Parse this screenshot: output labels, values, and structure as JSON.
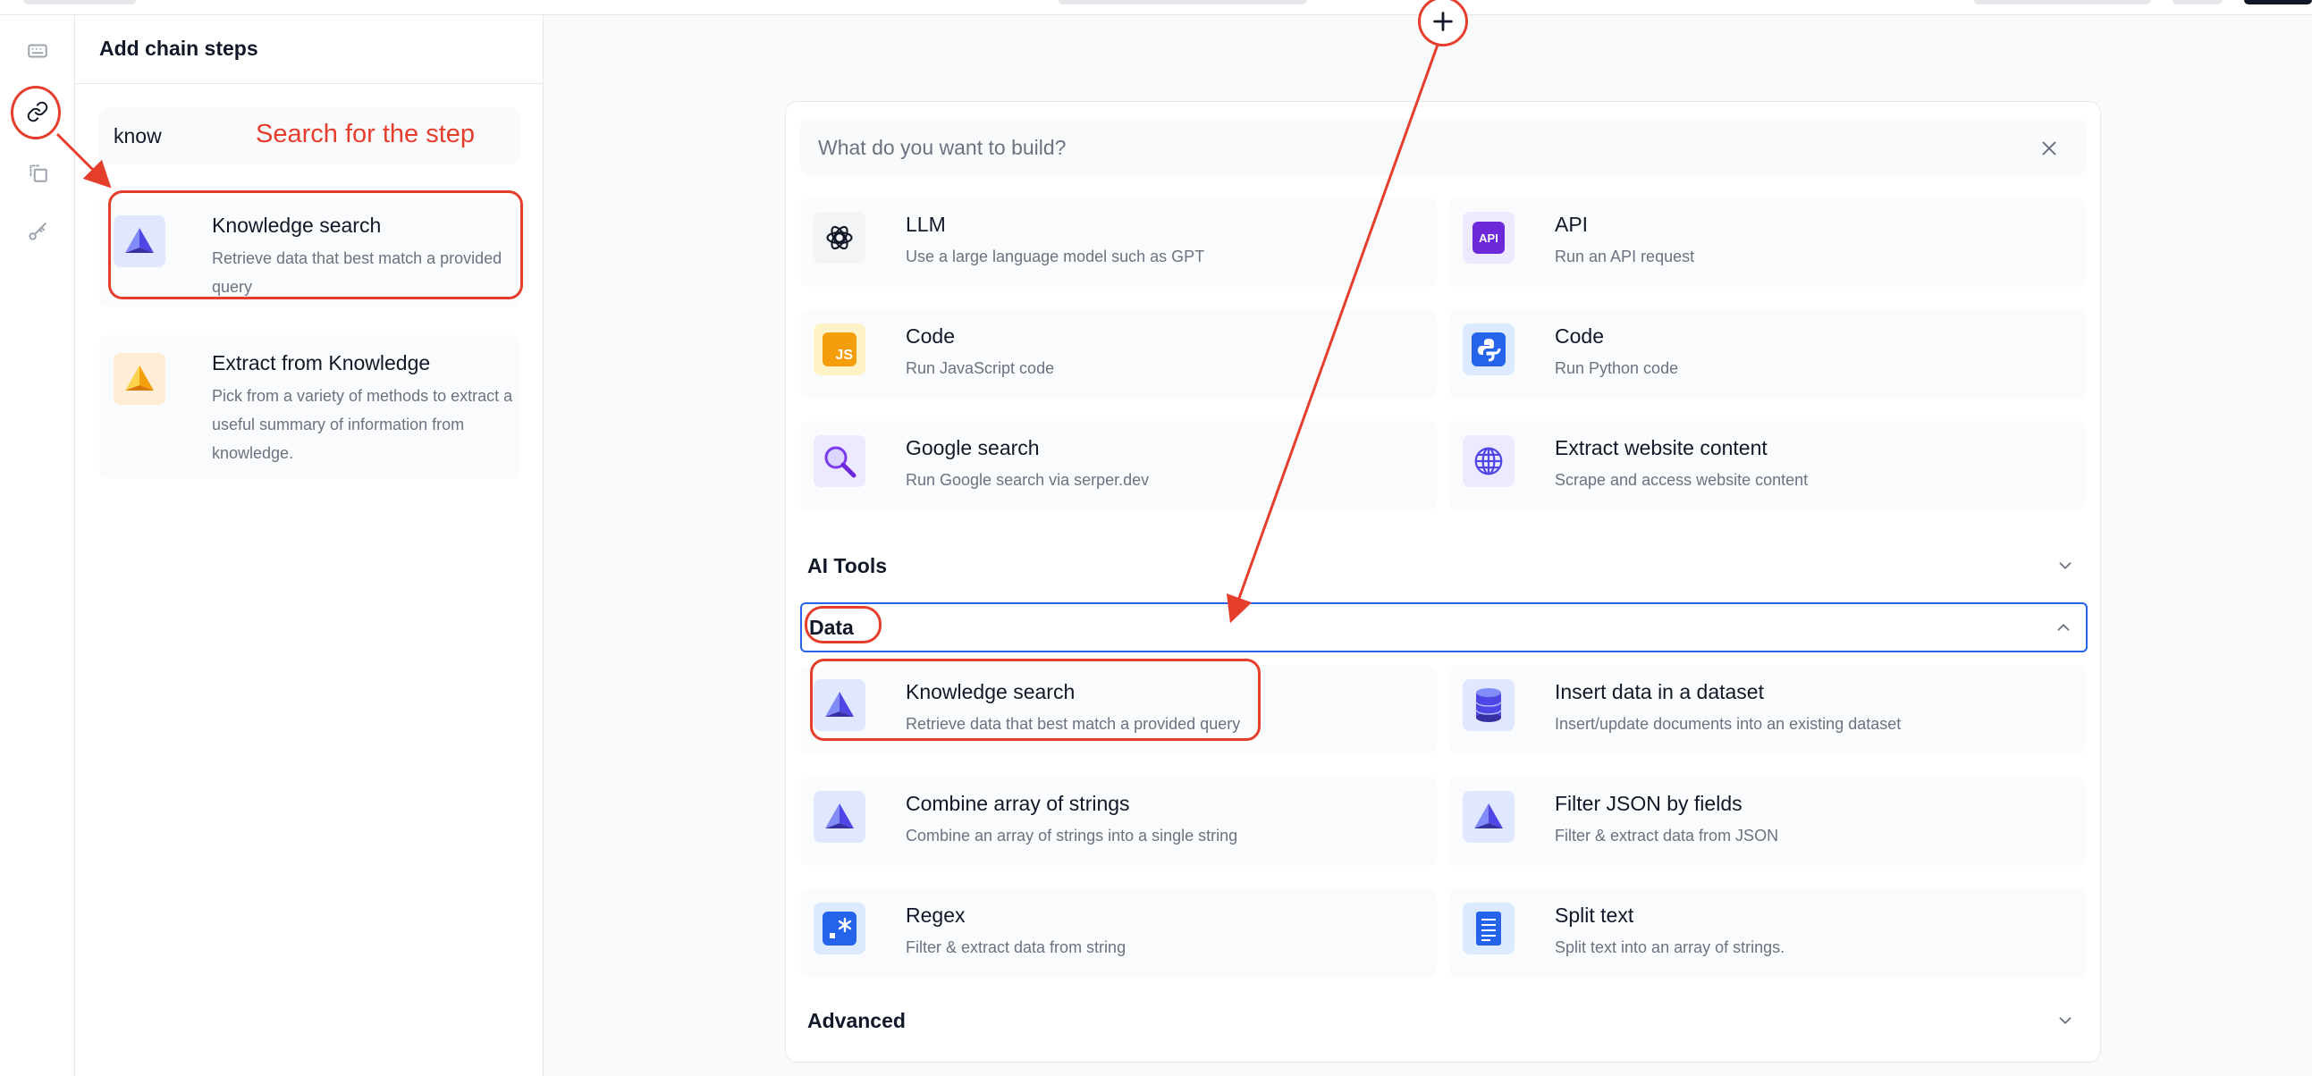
{
  "panel": {
    "title": "Add chain steps",
    "search_value": "know",
    "results": [
      {
        "title": "Knowledge search",
        "description": "Retrieve data that best match a provided query",
        "icon": "pyramid-blue-icon"
      },
      {
        "title": "Extract from Knowledge",
        "description": "Pick from a variety of methods to extract a useful summary of information from knowledge.",
        "icon": "pyramid-orange-icon"
      }
    ]
  },
  "rail": {
    "icons": [
      "keyboard-icon",
      "link-icon",
      "copy-icon",
      "key-icon"
    ]
  },
  "builder": {
    "search_placeholder": "What do you want to build?",
    "top_tiles": [
      {
        "title": "LLM",
        "description": "Use a large language model such as GPT",
        "icon": "openai-icon"
      },
      {
        "title": "API",
        "description": "Run an API request",
        "icon": "api-icon",
        "badge": "API"
      },
      {
        "title": "Code",
        "description": "Run JavaScript code",
        "icon": "javascript-icon",
        "badge": "JS"
      },
      {
        "title": "Code",
        "description": "Run Python code",
        "icon": "python-icon"
      },
      {
        "title": "Google search",
        "description": "Run Google search via serper.dev",
        "icon": "magnifier-icon"
      },
      {
        "title": "Extract website content",
        "description": "Scrape and access website content",
        "icon": "globe-icon"
      }
    ],
    "sections": {
      "ai_tools": "AI Tools",
      "data": "Data",
      "advanced": "Advanced"
    },
    "data_tiles": [
      {
        "title": "Knowledge search",
        "description": "Retrieve data that best match a provided query",
        "icon": "pyramid-blue-icon"
      },
      {
        "title": "Insert data in a dataset",
        "description": "Insert/update documents into an existing dataset",
        "icon": "database-icon"
      },
      {
        "title": "Combine array of strings",
        "description": "Combine an array of strings into a single string",
        "icon": "pyramid-blue-icon"
      },
      {
        "title": "Filter JSON by fields",
        "description": "Filter & extract data from JSON",
        "icon": "pyramid-blue-icon"
      },
      {
        "title": "Regex",
        "description": "Filter & extract data from string",
        "icon": "regex-icon"
      },
      {
        "title": "Split text",
        "description": "Split text into an array of strings.",
        "icon": "document-icon"
      }
    ]
  },
  "annotation": {
    "text": "Search for the step",
    "color": "#e53e2d"
  },
  "colors": {
    "accent": "#2563eb",
    "annotation": "#e53e2d",
    "text": "#111827",
    "muted": "#6b7280"
  }
}
